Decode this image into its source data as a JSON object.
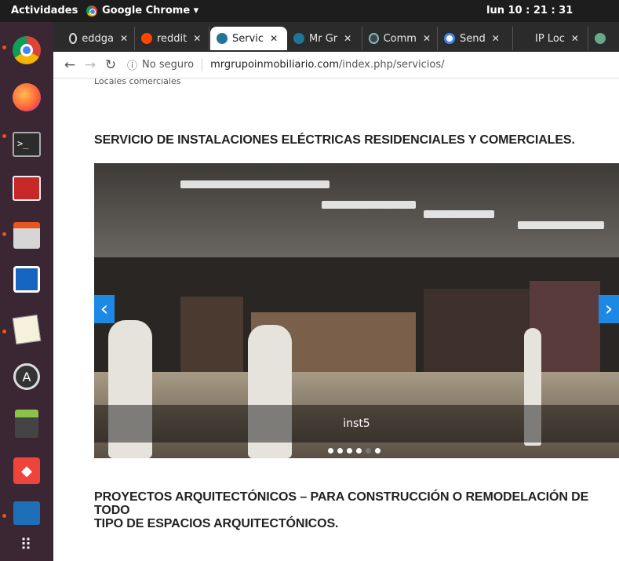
{
  "topbar": {
    "activities": "Actividades",
    "app_name": "Google Chrome ▾",
    "clock": "lun 10 : 21 : 31"
  },
  "tabs": [
    {
      "label": "eddga",
      "icon": "github-icon"
    },
    {
      "label": "reddit",
      "icon": "reddit-icon"
    },
    {
      "label": "Servic",
      "icon": "wordpress-icon"
    },
    {
      "label": "Mr Gr",
      "icon": "wordpress-icon"
    },
    {
      "label": "Comm",
      "icon": "eye-icon"
    },
    {
      "label": "Send",
      "icon": "google-icon"
    },
    {
      "label": "IP Loc",
      "icon": "blank-icon"
    }
  ],
  "toolbar": {
    "security": "No seguro",
    "url_host": "mrgrupoinmobiliario.com",
    "url_path": "/index.php/servicios/"
  },
  "page": {
    "cut_label": "Locales comerciales",
    "heading1": "SERVICIO DE INSTALACIONES ELÉCTRICAS  RESIDENCIALES Y COMERCIALES.",
    "slide_caption": "inst5",
    "slide_count": 6,
    "active_slide": 5,
    "heading2_line1": "PROYECTOS ARQUITECTÓNICOS –  PARA CONSTRUCCIÓN O REMODELACIÓN DE TODO",
    "heading2_line2": "TIPO DE ESPACIOS ARQUITECTÓNICOS."
  },
  "colors": {
    "accent": "#1e88e5",
    "launcher_bg": "#3b2633",
    "topbar_bg": "#1d1d1d"
  }
}
